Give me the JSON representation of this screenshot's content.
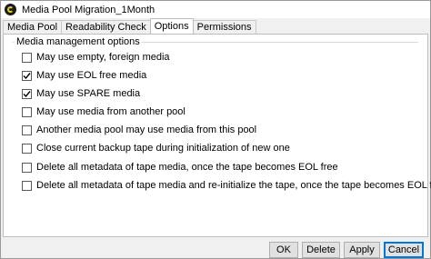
{
  "window": {
    "title": "Media Pool Migration_1Month"
  },
  "tabs": [
    {
      "label": "Media Pool",
      "active": false
    },
    {
      "label": "Readability Check",
      "active": false
    },
    {
      "label": "Options",
      "active": true
    },
    {
      "label": "Permissions",
      "active": false
    }
  ],
  "group": {
    "title": "Media management options"
  },
  "options": [
    {
      "label": "May use empty, foreign media",
      "checked": false
    },
    {
      "label": "May use EOL free media",
      "checked": true
    },
    {
      "label": "May use SPARE media",
      "checked": true
    },
    {
      "label": "May use media from another pool",
      "checked": false
    },
    {
      "label": "Another media pool may use media from this pool",
      "checked": false
    },
    {
      "label": "Close current backup tape during initialization of new one",
      "checked": false
    },
    {
      "label": "Delete all metadata of tape media, once the tape becomes EOL free",
      "checked": false
    },
    {
      "label": "Delete all metadata of tape media and re-initialize the tape, once the tape becomes EOL free",
      "checked": false
    }
  ],
  "buttons": {
    "ok": "OK",
    "delete": "Delete",
    "apply": "Apply",
    "cancel": "Cancel"
  },
  "colors": {
    "accent": "#0078d7",
    "icon": "#e7d21a"
  }
}
